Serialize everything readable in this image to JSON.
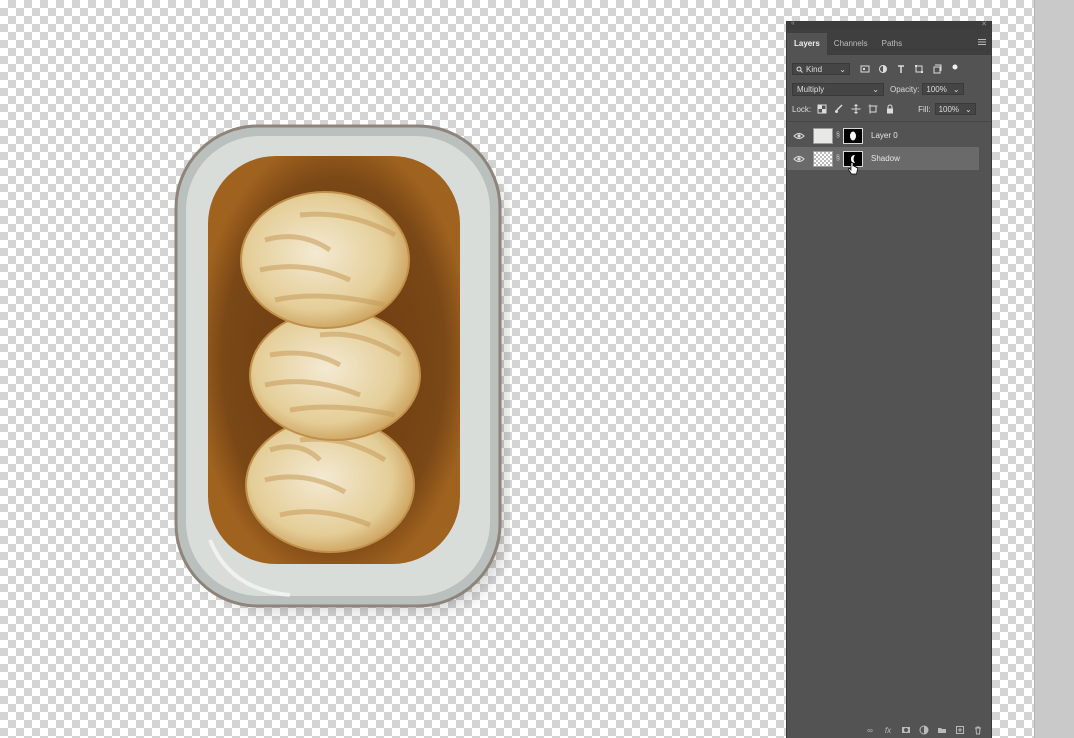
{
  "panel": {
    "tabs": [
      {
        "label": "Layers",
        "active": true
      },
      {
        "label": "Channels",
        "active": false
      },
      {
        "label": "Paths",
        "active": false
      }
    ],
    "filter": {
      "kind_label": "Kind"
    },
    "blend_mode": "Multiply",
    "opacity_label": "Opacity:",
    "opacity_value": "100%",
    "lock_label": "Lock:",
    "fill_label": "Fill:",
    "fill_value": "100%",
    "layers": [
      {
        "name": "Layer 0",
        "selected": false,
        "visible": true
      },
      {
        "name": "Shadow",
        "selected": true,
        "visible": true
      }
    ],
    "bottom_icons": [
      "link-icon",
      "fx-icon",
      "add-mask-icon",
      "adjustment-icon",
      "group-folder-icon",
      "new-layer-icon",
      "trash-icon"
    ]
  },
  "colors": {
    "panel_bg": "#535353",
    "selected_row": "#6a6a6a",
    "canvas_checker": "#d4d4d4"
  }
}
